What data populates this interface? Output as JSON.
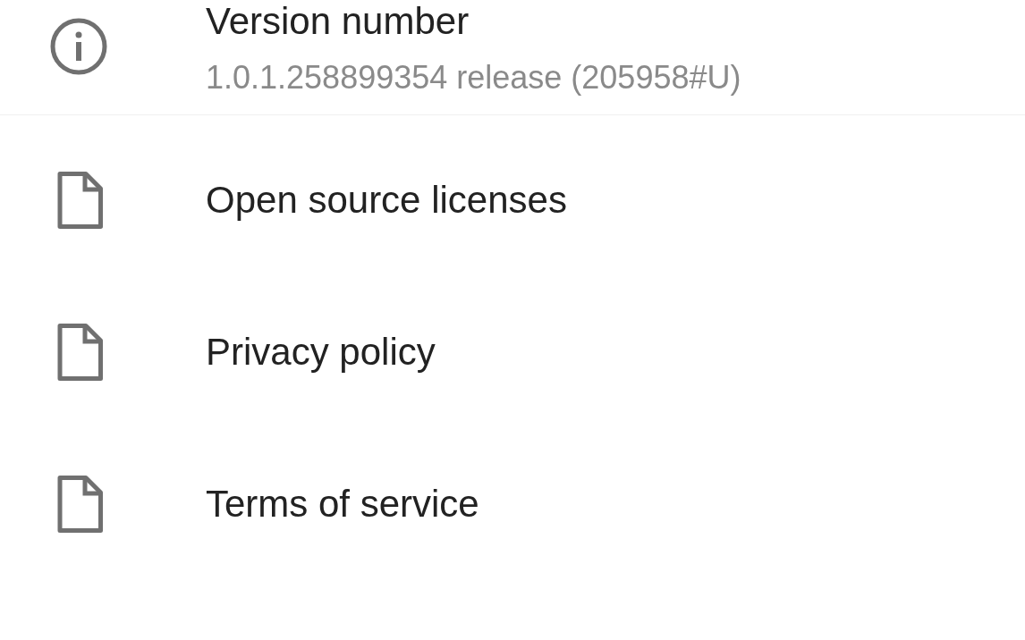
{
  "items": [
    {
      "kind": "info",
      "title": "Version number",
      "subtitle": "1.0.1.258899354 release (205958#U)"
    },
    {
      "kind": "document",
      "title": "Open source licenses"
    },
    {
      "kind": "document",
      "title": "Privacy policy"
    },
    {
      "kind": "document",
      "title": "Terms of service"
    }
  ]
}
